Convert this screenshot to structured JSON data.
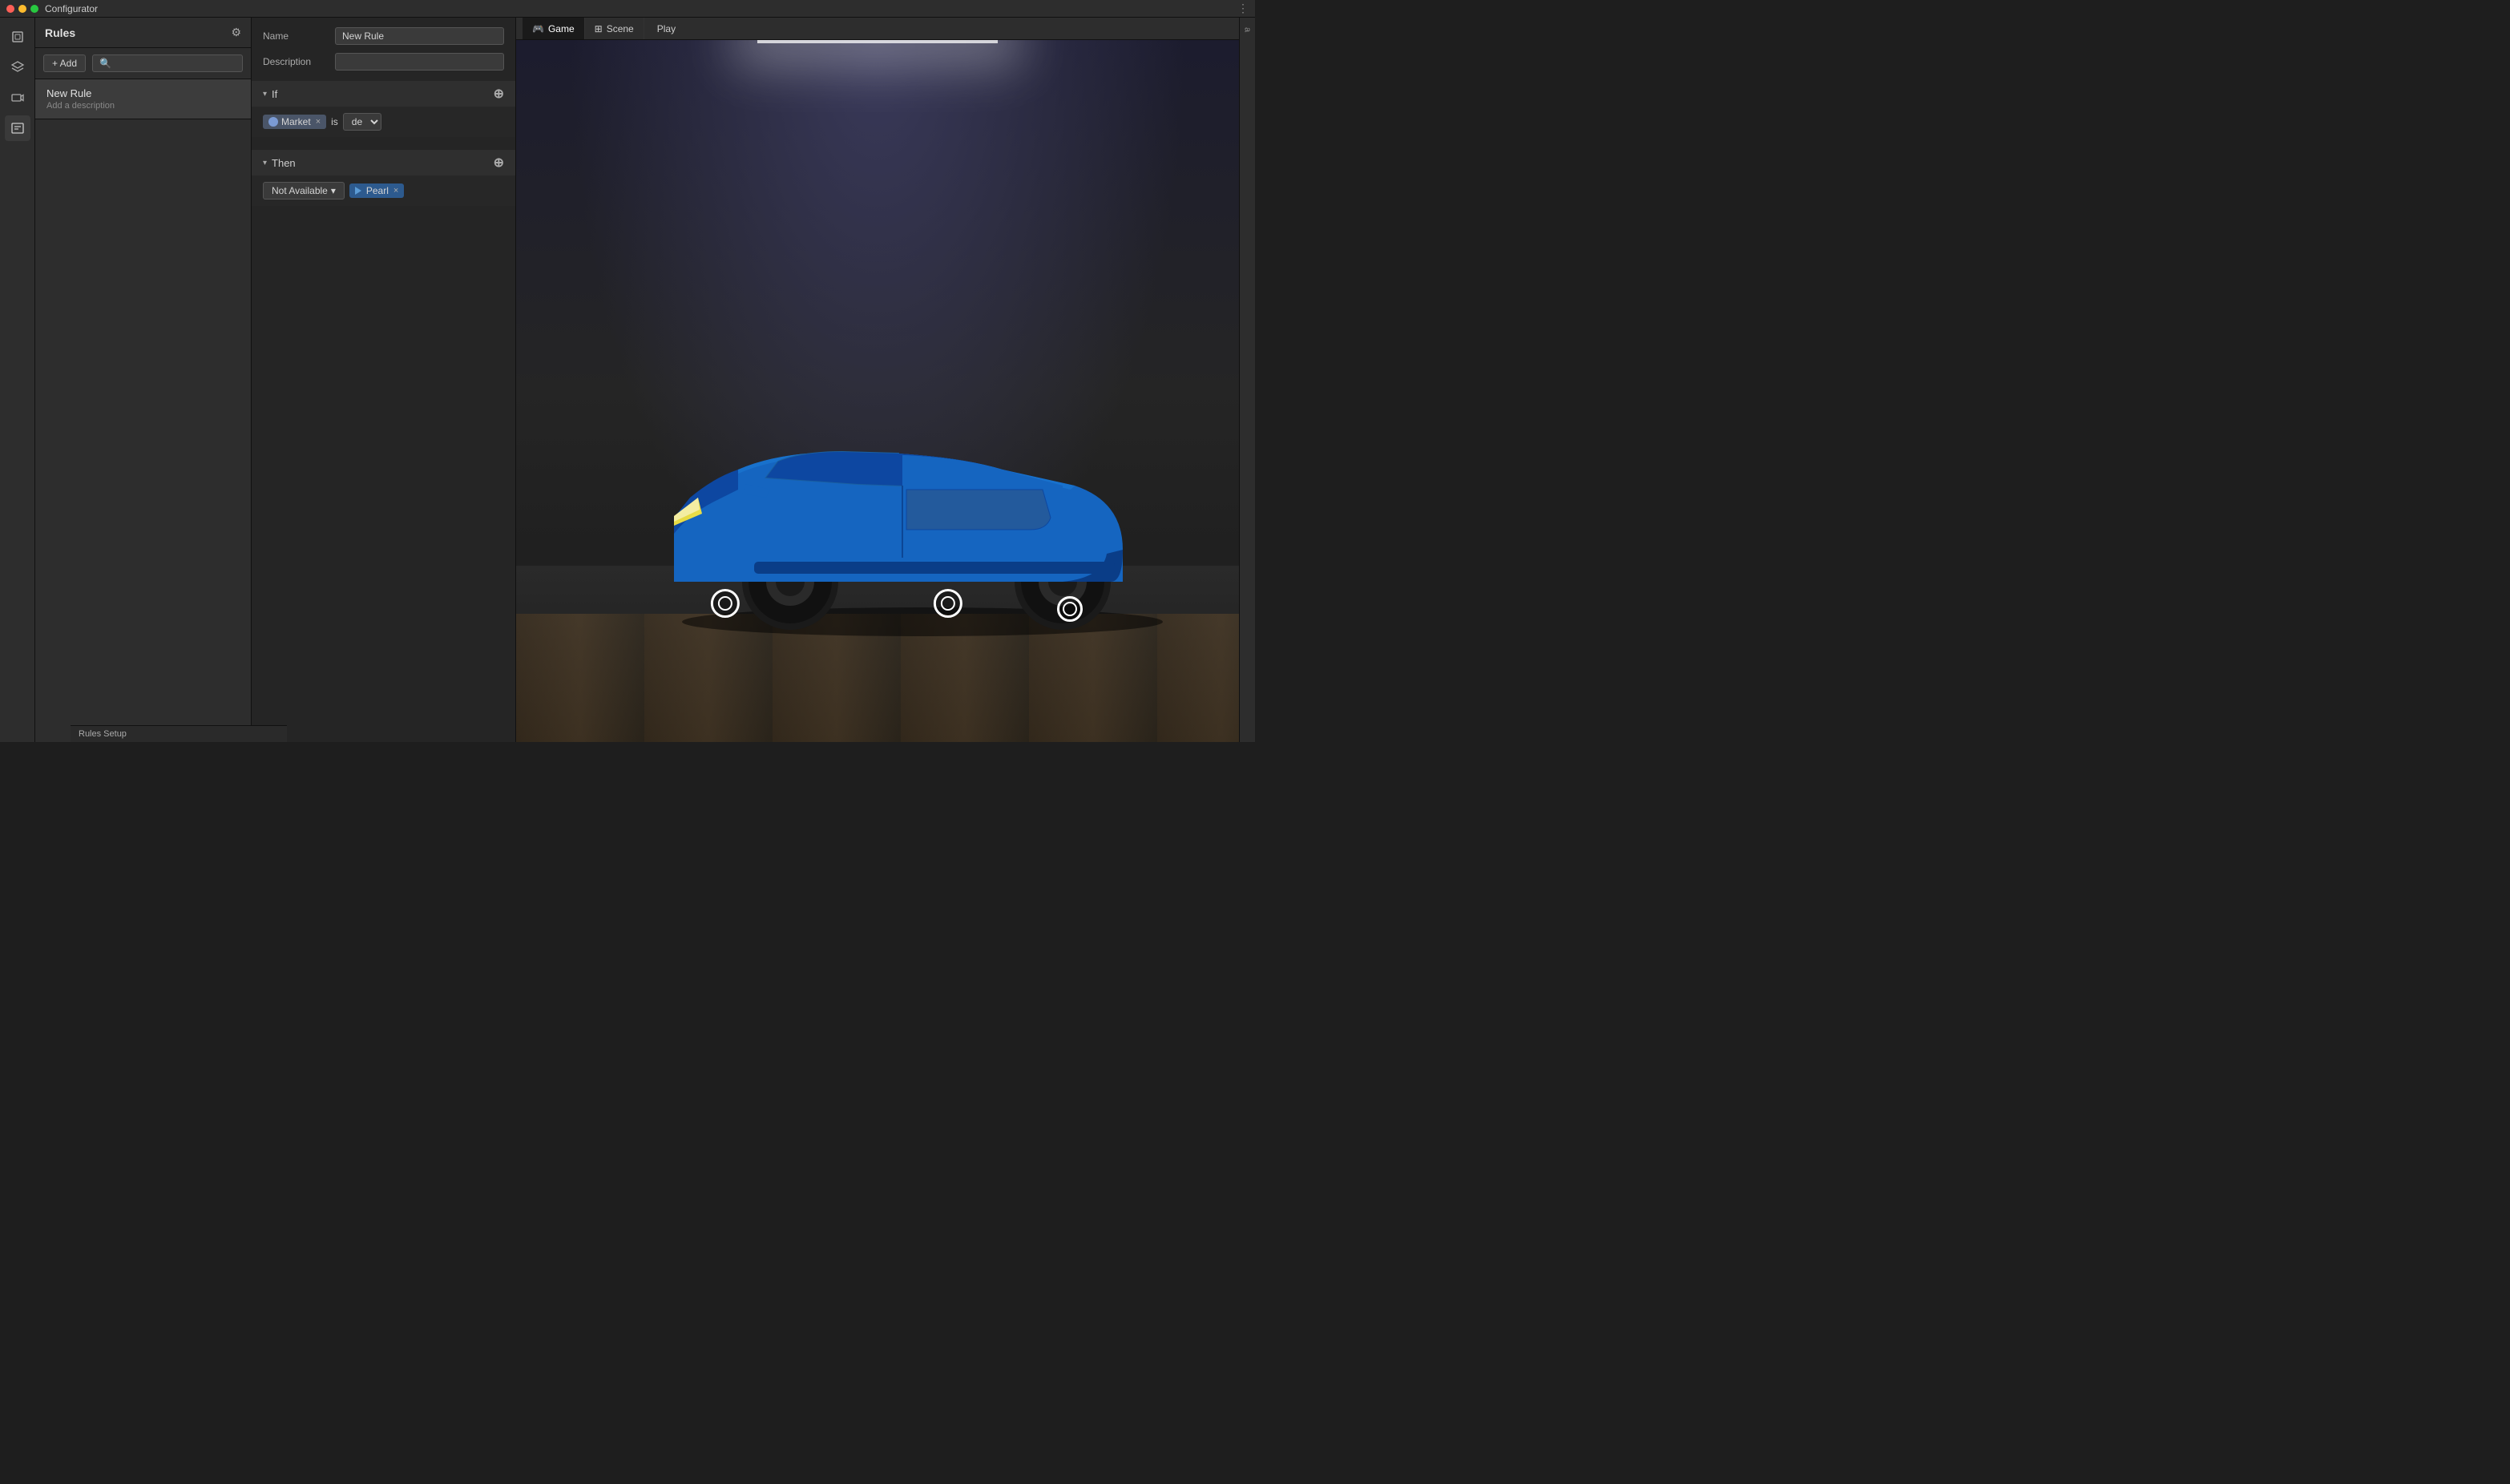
{
  "titleBar": {
    "title": "Configurator",
    "dotsVisible": true
  },
  "rulesPanel": {
    "title": "Rules",
    "addButton": "+ Add",
    "searchPlaceholder": "🔍",
    "rules": [
      {
        "name": "New Rule",
        "description": "Add a description"
      }
    ]
  },
  "ruleEditor": {
    "nameLabel": "Name",
    "nameValue": "New Rule",
    "descriptionLabel": "Description",
    "descriptionValue": "",
    "ifSection": {
      "label": "If",
      "condition": {
        "tag": "Market",
        "operator": "is",
        "value": "de"
      }
    },
    "thenSection": {
      "label": "Then",
      "action": {
        "dropdown": "Not Available",
        "tag": "Pearl"
      }
    }
  },
  "viewport": {
    "tabs": [
      {
        "label": "Game",
        "icon": "🎮",
        "active": true
      },
      {
        "label": "Scene",
        "icon": "⊞",
        "active": false
      }
    ],
    "playButton": "Play"
  },
  "bottomLabel": {
    "text": "Rules Setup"
  },
  "icons": {
    "gear": "⚙",
    "chevronDown": "▾",
    "plus": "+",
    "close": "×",
    "threeDots": "⋮",
    "grid": "⊞",
    "gamepad": "🎮",
    "layers": "≡",
    "camera": "▶"
  }
}
